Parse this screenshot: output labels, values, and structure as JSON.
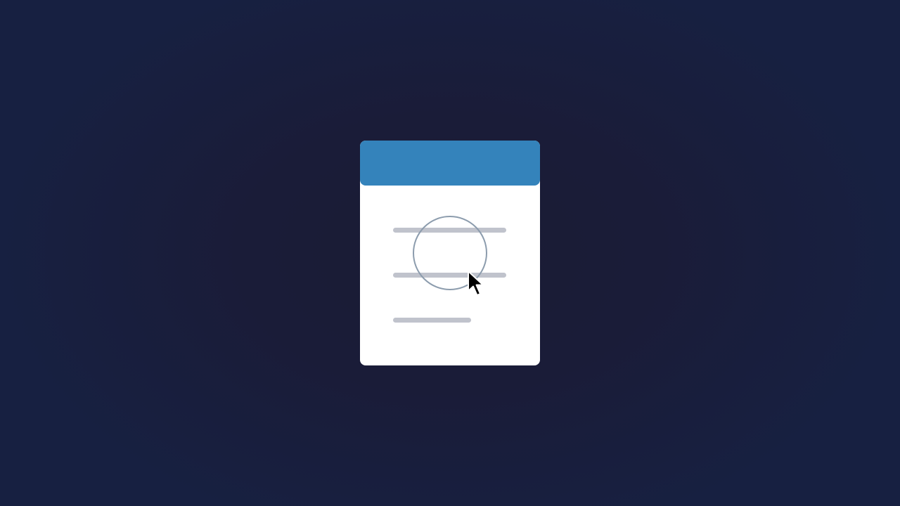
{
  "scene": {
    "background_color": "#1a1c38",
    "card": {
      "header_color": "#3483bb",
      "body_color": "#ffffff",
      "line_color": "#c0c3cc",
      "lines": [
        {
          "name": "content-line-1"
        },
        {
          "name": "content-line-2"
        },
        {
          "name": "content-line-3"
        }
      ]
    },
    "focus_indicator": {
      "shape": "circle",
      "color": "#8c9cad"
    },
    "cursor": {
      "icon": "arrow-pointer-icon",
      "color": "#000000"
    }
  }
}
